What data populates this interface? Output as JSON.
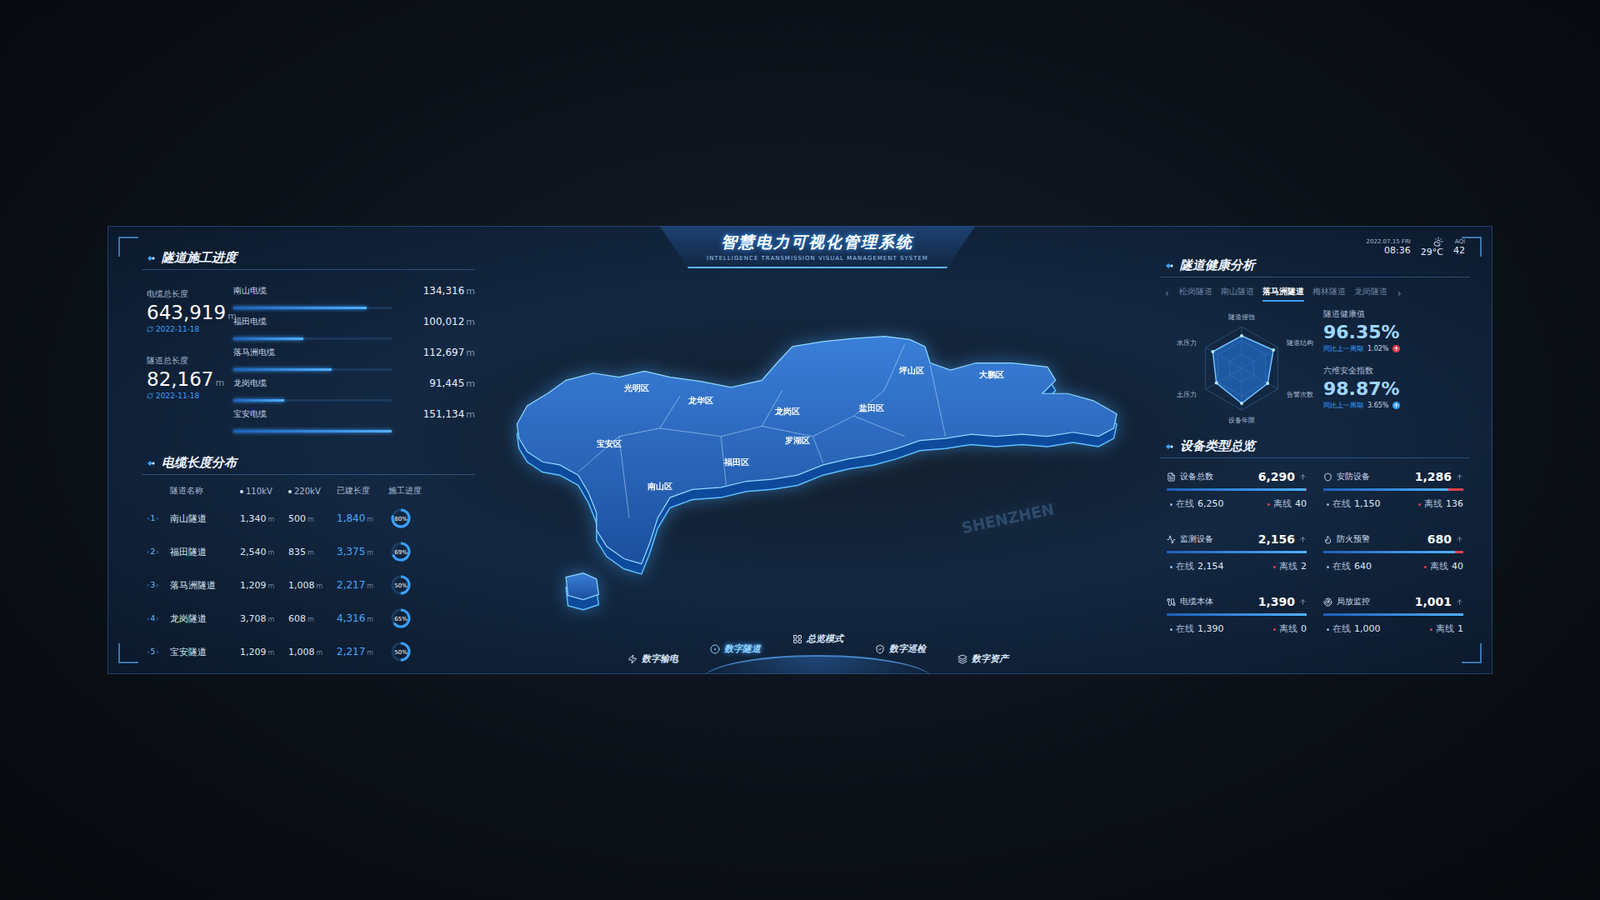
{
  "header": {
    "title": "智慧电力可视化管理系统",
    "subtitle": "INTELLIGENCE TRANSMISSION VISUAL MANAGEMENT SYSTEM"
  },
  "status": {
    "date": "2022.07.15 FRI",
    "time": "08:36",
    "temperature": "29°C",
    "aqi_label": "AQI",
    "aqi": "42"
  },
  "construction": {
    "title": "隧道施工进度",
    "totals": [
      {
        "label": "电缆总长度",
        "value": "643,919",
        "unit": "m",
        "date": "2022-11-18"
      },
      {
        "label": "隧道总长度",
        "value": "82,167",
        "unit": "m",
        "date": "2022-11-18"
      }
    ],
    "cables": [
      {
        "name": "南山电缆",
        "value": "134,316",
        "unit": "m",
        "level": 0.84
      },
      {
        "name": "福田电缆",
        "value": "100,012",
        "unit": "m",
        "level": 0.44
      },
      {
        "name": "落马洲电缆",
        "value": "112,697",
        "unit": "m",
        "level": 0.62
      },
      {
        "name": "龙岗电缆",
        "value": "91,445",
        "unit": "m",
        "level": 0.32
      },
      {
        "name": "宝安电缆",
        "value": "151,134",
        "unit": "m",
        "level": 1.0
      }
    ]
  },
  "distribution": {
    "title": "电缆长度分布",
    "columns": [
      "隧道名称",
      "110kV",
      "220kV",
      "已建长度",
      "施工进度"
    ],
    "rows": [
      {
        "index": "1",
        "name": "南山隧道",
        "kv110": "1,340",
        "kv220": "500",
        "built": "1,840",
        "unit": "m",
        "progress": "80%",
        "level": 0.8
      },
      {
        "index": "2",
        "name": "福田隧道",
        "kv110": "2,540",
        "kv220": "835",
        "built": "3,375",
        "unit": "m",
        "progress": "69%",
        "level": 0.69
      },
      {
        "index": "3",
        "name": "落马洲隧道",
        "kv110": "1,209",
        "kv220": "1,008",
        "built": "2,217",
        "unit": "m",
        "progress": "50%",
        "level": 0.5
      },
      {
        "index": "4",
        "name": "龙岗隧道",
        "kv110": "3,708",
        "kv220": "608",
        "built": "4,316",
        "unit": "m",
        "progress": "65%",
        "level": 0.65
      },
      {
        "index": "5",
        "name": "宝安隧道",
        "kv110": "1,209",
        "kv220": "1,008",
        "built": "2,217",
        "unit": "m",
        "progress": "50%",
        "level": 0.5
      }
    ]
  },
  "map": {
    "districts": [
      "光明区",
      "龙华区",
      "龙岗区",
      "盐田区",
      "坪山区",
      "大鹏区",
      "宝安区",
      "南山区",
      "福田区",
      "罗湖区"
    ],
    "watermark": "SHENZHEN"
  },
  "nav": [
    {
      "label": "数字输电",
      "selected": false
    },
    {
      "label": "数字隧道",
      "selected": true
    },
    {
      "label": "总览模式",
      "selected": false
    },
    {
      "label": "数字巡检",
      "selected": false
    },
    {
      "label": "数字资产",
      "selected": false
    }
  ],
  "health": {
    "title": "隧道健康分析",
    "prev": "‹",
    "next": "›",
    "tabs": [
      {
        "label": "松岗隧道",
        "selected": false
      },
      {
        "label": "南山隧道",
        "selected": false
      },
      {
        "label": "落马洲隧道",
        "selected": true
      },
      {
        "label": "梅林隧道",
        "selected": false
      },
      {
        "label": "龙岗隧道",
        "selected": false
      }
    ],
    "radar": {
      "axes": [
        "隧道侵蚀",
        "隧道结构",
        "告警次数",
        "设备年限",
        "土压力",
        "水压力"
      ],
      "values": [
        78,
        88,
        72,
        84,
        70,
        80
      ]
    },
    "stats": [
      {
        "label": "隧道健康值",
        "value": "96.35%",
        "compare_label": "同比上一周期",
        "compare": "1.02%",
        "color": "#e0404a"
      },
      {
        "label": "六维安全指数",
        "value": "98.87%",
        "compare_label": "同比上一周期",
        "compare": "3.65%",
        "color": "#3aa0ff"
      }
    ]
  },
  "equipment": {
    "title": "设备类型总览",
    "online_label": "在线",
    "offline_label": "离线",
    "items": [
      {
        "name": "设备总数",
        "total": "6,290",
        "online": "6,250",
        "offline": "40",
        "level": 0.994
      },
      {
        "name": "安防设备",
        "total": "1,286",
        "online": "1,150",
        "offline": "136",
        "level": 0.894
      },
      {
        "name": "监测设备",
        "total": "2,156",
        "online": "2,154",
        "offline": "2",
        "level": 0.999
      },
      {
        "name": "防火预警",
        "total": "680",
        "online": "640",
        "offline": "40",
        "level": 0.941
      },
      {
        "name": "电缆本体",
        "total": "1,390",
        "online": "1,390",
        "offline": "0",
        "level": 1.0
      },
      {
        "name": "局放监控",
        "total": "1,001",
        "online": "1,000",
        "offline": "1",
        "level": 0.999
      }
    ]
  }
}
